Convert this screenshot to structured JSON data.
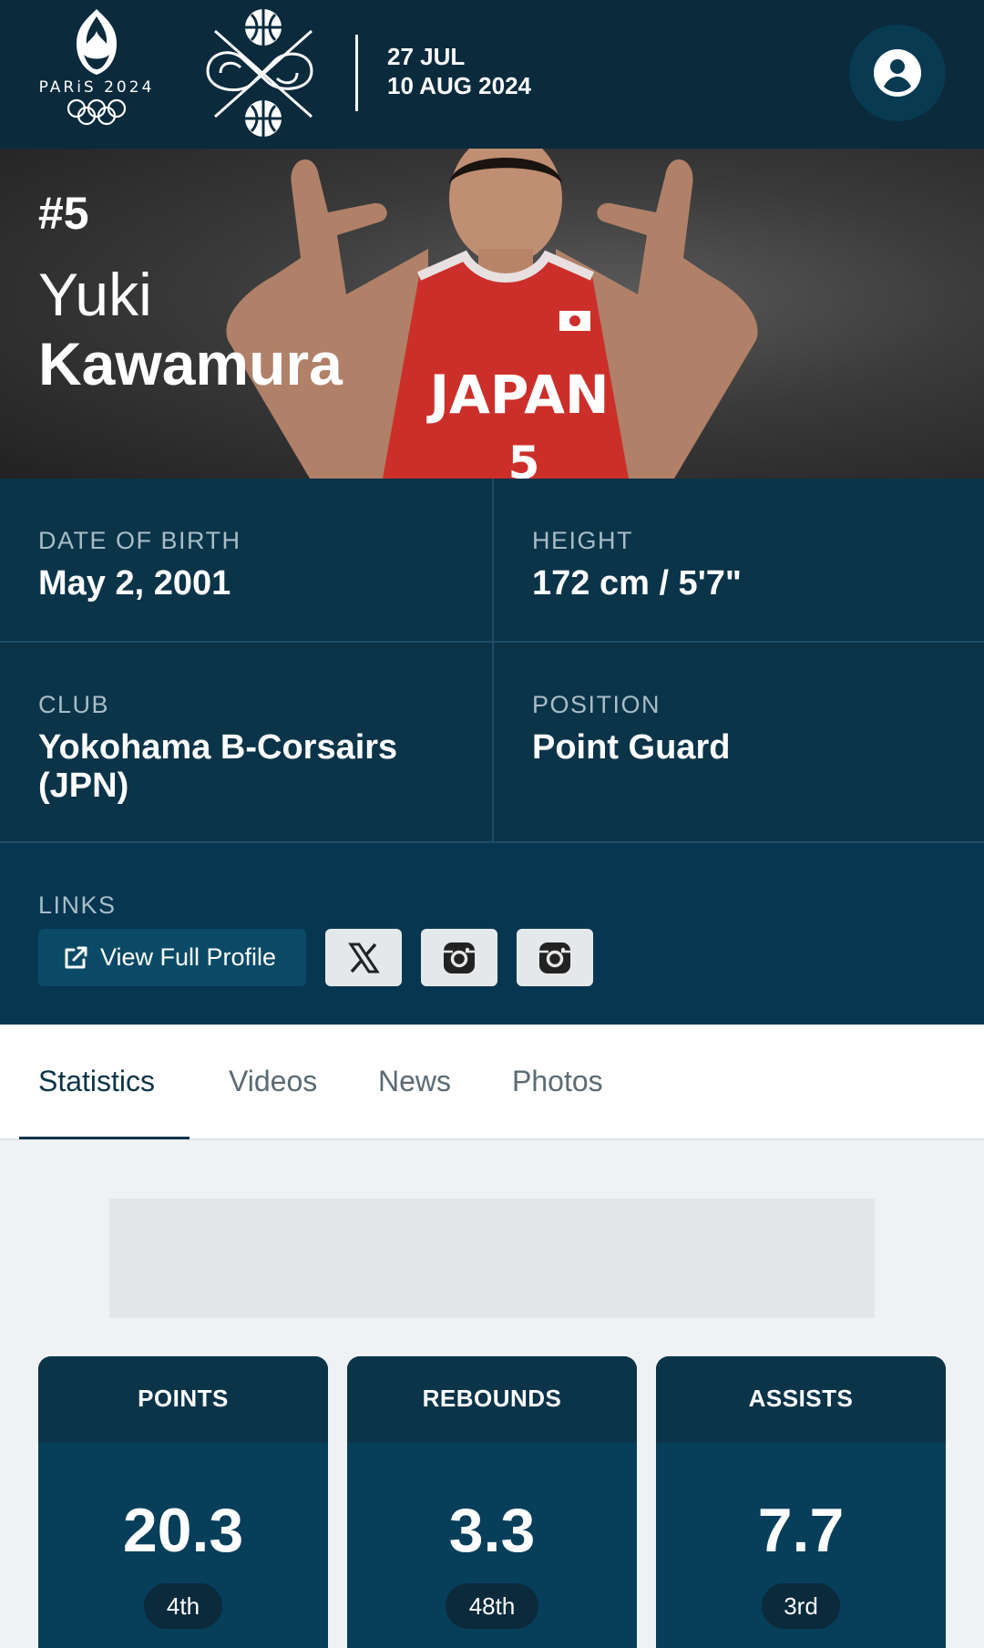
{
  "header": {
    "brand_text": "PARiS 2024",
    "dates": {
      "start": "27 JUL",
      "end": "10 AUG 2024"
    },
    "icons": [
      "paris-flame-icon",
      "olympic-rings-icon",
      "basketball-3x3-logo-icon",
      "user-icon"
    ]
  },
  "player": {
    "number": "#5",
    "first_name": "Yuki",
    "last_name": "Kawamura",
    "jersey_text": "JAPAN"
  },
  "details": {
    "dob": {
      "label": "DATE OF BIRTH",
      "value": "May 2, 2001"
    },
    "height": {
      "label": "HEIGHT",
      "value": "172 cm / 5'7\""
    },
    "club": {
      "label": "CLUB",
      "value_line1": "Yokohama B-Corsairs",
      "value_line2": "(JPN)"
    },
    "position": {
      "label": "POSITION",
      "value": "Point Guard"
    }
  },
  "links": {
    "label": "LINKS",
    "profile_button": "View Full Profile",
    "social_icons": [
      "x-icon",
      "instagram-icon",
      "instagram-icon"
    ]
  },
  "tabs": [
    {
      "label": "Statistics",
      "active": true
    },
    {
      "label": "Videos",
      "active": false
    },
    {
      "label": "News",
      "active": false
    },
    {
      "label": "Photos",
      "active": false
    }
  ],
  "stats": [
    {
      "title": "POINTS",
      "value": "20.3",
      "rank": "4th"
    },
    {
      "title": "REBOUNDS",
      "value": "3.3",
      "rank": "48th"
    },
    {
      "title": "ASSISTS",
      "value": "7.7",
      "rank": "3rd"
    }
  ],
  "colors": {
    "header_bg": "#0b2a3c",
    "info_bg": "#0b3449",
    "accent_dark": "#073651",
    "tab_active": "#0b3449"
  }
}
